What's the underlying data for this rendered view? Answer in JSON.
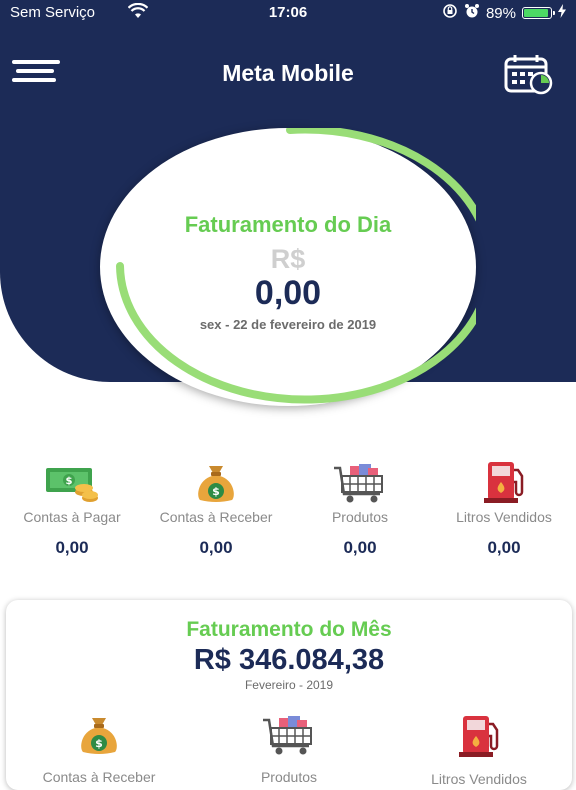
{
  "status_bar": {
    "carrier": "Sem Serviço",
    "time": "17:06",
    "battery": "89%",
    "battery_level": 0.89
  },
  "header": {
    "title": "Meta Mobile"
  },
  "day_card": {
    "title": "Faturamento do Dia",
    "currency": "R$",
    "value": "0,00",
    "date": "sex - 22 de fevereiro de 2019",
    "ring_color": "#99dd77"
  },
  "quick_stats": [
    {
      "label": "Contas à Pagar",
      "value": "0,00",
      "icon": "money-bill-icon"
    },
    {
      "label": "Contas à Receber",
      "value": "0,00",
      "icon": "money-bag-icon"
    },
    {
      "label": "Produtos",
      "value": "0,00",
      "icon": "shopping-cart-icon"
    },
    {
      "label": "Litros Vendidos",
      "value": "0,00",
      "icon": "fuel-pump-icon"
    }
  ],
  "month_card": {
    "title": "Faturamento do Mês",
    "value": "R$ 346.084,38",
    "period": "Fevereiro - 2019",
    "items": [
      {
        "label": "Contas à Receber",
        "icon": "money-bag-icon"
      },
      {
        "label": "Produtos",
        "icon": "shopping-cart-icon"
      },
      {
        "label": "Litros Vendidos",
        "icon": "fuel-pump-icon"
      }
    ]
  },
  "colors": {
    "navy": "#1c2b57",
    "green": "#66cc52",
    "gray": "#8a8a8a"
  }
}
